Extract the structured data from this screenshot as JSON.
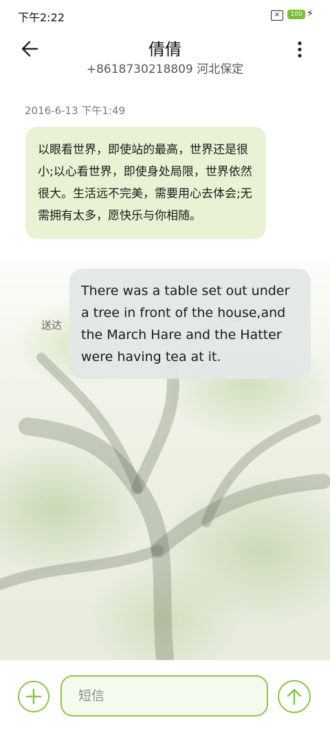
{
  "status_bar": {
    "time": "下午2:22",
    "sim_icon_label": "×",
    "battery": "100"
  },
  "header": {
    "title": "倩倩",
    "subtitle": "+8618730218809 河北保定"
  },
  "messages": {
    "timestamp": "2016-6-13 下午1:49",
    "incoming_text": "以眼看世界，即使站的最高，世界还是很小;以心看世界，即使身处局限，世界依然很大。生活远不完美，需要用心去体会;无需拥有太多，愿快乐与你相随。",
    "outgoing_text": "There was a table set out under a tree in front of the house,and the March Hare and the Hatter were having tea at it.",
    "outgoing_status": "送达"
  },
  "composer": {
    "placeholder": "短信"
  },
  "colors": {
    "accent": "#8cc44c",
    "incoming_bubble": "#e8f3d6",
    "outgoing_bubble": "#e1e8e6"
  },
  "icons": [
    "back-arrow-icon",
    "more-vert-icon",
    "plus-icon",
    "send-arrow-icon",
    "sim-icon",
    "battery-icon"
  ]
}
